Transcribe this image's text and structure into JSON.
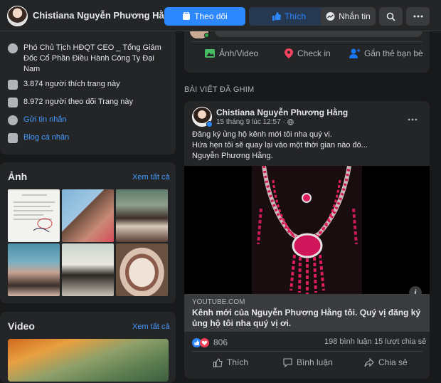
{
  "header": {
    "page_name": "Chistiana Nguyễn Phương Hằng",
    "follow_label": "Theo dõi",
    "like_label": "Thích",
    "message_label": "Nhắn tin"
  },
  "intro": {
    "title": "Phó Chủ Tịch HĐQT CEO _ Tổng Giám Đốc Cổ Phần Điều Hành Công Ty Đại Nam",
    "likes": "3.874 người thích trang này",
    "followers": "8.972 người theo dõi Trang này",
    "send_message": "Gửi tin nhắn",
    "blog": "Blog cá nhân"
  },
  "photos": {
    "title": "Ảnh",
    "see_all": "Xem tất cả"
  },
  "videos": {
    "title": "Video",
    "see_all": "Xem tất cả"
  },
  "composer": {
    "photo_video": "Ảnh/Video",
    "check_in": "Check in",
    "tag_friends": "Gắn thẻ bạn bè"
  },
  "pinned": {
    "label": "BÀI VIẾT ĐÃ GHIM"
  },
  "post": {
    "author": "Chistiana Nguyễn Phương Hằng",
    "time": "15 tháng 9 lúc 12:57 ·",
    "line1": "Đăng ký ủng hộ kênh mới tôi nha quý vị.",
    "line2": "Hứa hẹn tôi sẽ quay lại vào một thời gian nào đó...",
    "line3": "Nguyễn Phương Hằng.",
    "link_domain": "YOUTUBE.COM",
    "link_title": "Kênh mới của Nguyễn Phương Hằng tôi. Quý vị đăng ký ủng hộ tôi nha quý vị ơi.",
    "reactions": "806",
    "comments": "198 bình luận",
    "shares": "15 lượt chia sẻ",
    "like_action": "Thích",
    "comment_action": "Bình luận",
    "share_action": "Chia sẻ",
    "info_icon": "i"
  },
  "colors": {
    "accent": "#2d88ff",
    "link": "#4599ff",
    "background": "#18191a",
    "card": "#242526"
  }
}
